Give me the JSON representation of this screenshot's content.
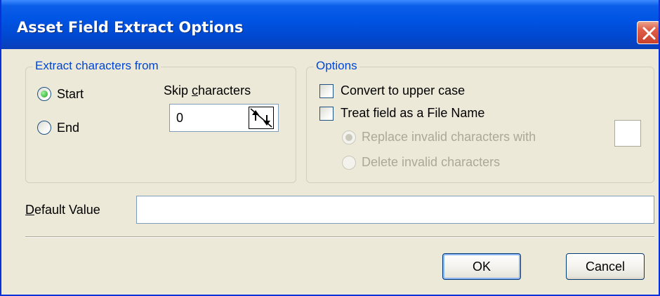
{
  "dialog": {
    "title": "Asset Field Extract Options",
    "close_icon": "close-x-icon"
  },
  "extract_group": {
    "label": "Extract characters from",
    "start_label": "Start",
    "start_selected": true,
    "end_label": "End",
    "end_selected": false,
    "skip_label_prefix": "Skip ",
    "skip_label_accel": "c",
    "skip_label_suffix": "haracters",
    "skip_value": "0",
    "spin_icon": "spin-up-down-icon"
  },
  "options_group": {
    "label": "Options",
    "upper_case_label": "Convert to upper case",
    "upper_case_checked": false,
    "file_name_label": "Treat field as a File Name",
    "file_name_checked": false,
    "replace_label": "Replace invalid characters with",
    "replace_selected": true,
    "replace_value": "",
    "delete_label": "Delete invalid characters",
    "delete_selected": false
  },
  "default_value": {
    "label_accel": "D",
    "label_rest": "efault Value",
    "value": ""
  },
  "buttons": {
    "ok": "OK",
    "cancel": "Cancel"
  },
  "colors": {
    "title_bar": "#0054e3",
    "group_label": "#0046d5",
    "dialog_bg": "#ece9d8",
    "disabled_text": "#aca899"
  }
}
